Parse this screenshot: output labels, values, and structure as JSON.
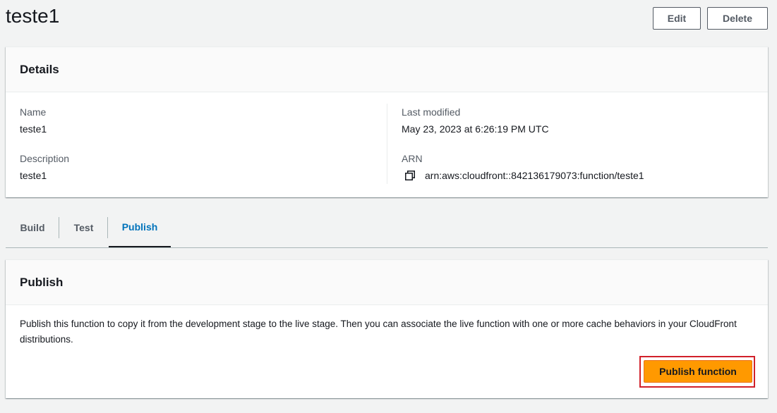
{
  "page": {
    "title": "teste1",
    "edit_label": "Edit",
    "delete_label": "Delete"
  },
  "details": {
    "title": "Details",
    "name_label": "Name",
    "name_value": "teste1",
    "description_label": "Description",
    "description_value": "teste1",
    "last_modified_label": "Last modified",
    "last_modified_value": "May 23, 2023 at 6:26:19 PM UTC",
    "arn_label": "ARN",
    "arn_value": "arn:aws:cloudfront::842136179073:function/teste1",
    "arn_icon": "copy-icon"
  },
  "tabs": [
    {
      "label": "Build",
      "active": false
    },
    {
      "label": "Test",
      "active": false
    },
    {
      "label": "Publish",
      "active": true
    }
  ],
  "publish": {
    "title": "Publish",
    "description": "Publish this function to copy it from the development stage to the live stage. Then you can associate the live function with one or more cache behaviors in your CloudFront distributions.",
    "button_label": "Publish function"
  },
  "colors": {
    "background": "#f2f3f3",
    "primary_button": "#ff9900",
    "active_tab": "#0073bb",
    "highlight": "#d1202a"
  }
}
